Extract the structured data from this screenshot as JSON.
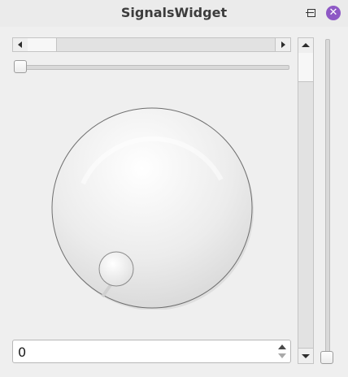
{
  "window": {
    "title": "SignalsWidget",
    "controls": {
      "close_icon": "close-icon",
      "close_glyph": "✕"
    },
    "accent_color": "#8e58c5"
  },
  "horizontal_scrollbar": {
    "value": 0
  },
  "horizontal_slider": {
    "value": 0
  },
  "dial": {
    "value": 0,
    "notches": false
  },
  "spin_box": {
    "value": "0"
  },
  "vertical_scrollbar": {
    "value": 0
  },
  "vertical_slider": {
    "value": 0
  }
}
